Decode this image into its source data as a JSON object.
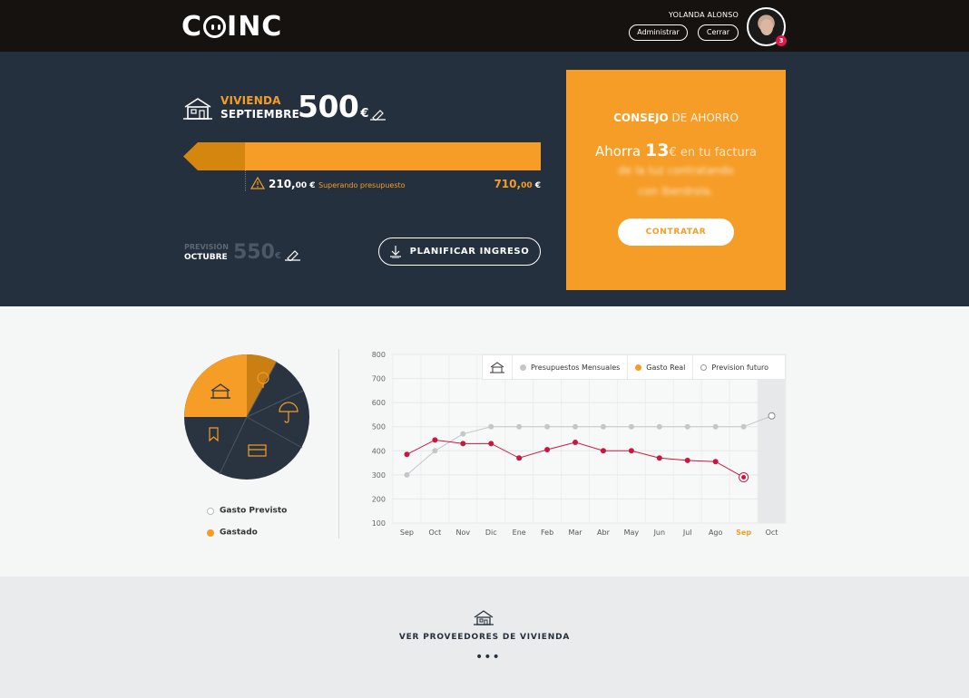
{
  "header": {
    "logo": "COINC",
    "user_name": "YOLANDA ALONSO",
    "admin_label": "Administrar",
    "logout_label": "Cerrar",
    "notifications": "3"
  },
  "budget": {
    "category": "VIVIENDA",
    "month": "SEPTIEMBRE",
    "amount": "500",
    "currency": "€",
    "progress_spent_fraction": 1.42,
    "over_amount_int": "210,",
    "over_amount_cents": "00",
    "over_currency": " €",
    "over_label": "Superando presupuesto",
    "spent_int": "710,",
    "spent_cents": "00",
    "spent_currency": " €"
  },
  "forecast": {
    "label": "PREVISIÓN",
    "month": "OCTUBRE",
    "amount": "550",
    "currency": "€",
    "plan_button": "PLANIFICAR INGRESO"
  },
  "tip": {
    "title_bold": "CONSEJO",
    "title_rest": " DE AHORRO",
    "lead": "Ahorra ",
    "amount": "13",
    "rest": "€ en tu factura",
    "line2": "de la luz contratando",
    "line3": "con Iberdrola.",
    "button": "CONTRATAR"
  },
  "pie_legend": {
    "planned": "Gasto Previsto",
    "spent": "Gastado"
  },
  "chart_legend": {
    "monthly": "Presupuestos Mensuales",
    "real": "Gasto Real",
    "future": "Prevision futuro"
  },
  "chart_data": {
    "type": "line",
    "categories": [
      "Sep",
      "Oct",
      "Nov",
      "Dic",
      "Ene",
      "Feb",
      "Mar",
      "Abr",
      "May",
      "Jun",
      "Jul",
      "Ago",
      "Sep",
      "Oct"
    ],
    "ylim": [
      100,
      800
    ],
    "yticks": [
      100,
      200,
      300,
      400,
      500,
      600,
      700,
      800
    ],
    "series": [
      {
        "name": "Presupuestos Mensuales",
        "values": [
          300,
          400,
          470,
          500,
          500,
          500,
          500,
          500,
          500,
          500,
          500,
          500,
          500,
          null
        ]
      },
      {
        "name": "Gasto Real",
        "values": [
          385,
          445,
          430,
          430,
          370,
          405,
          435,
          400,
          400,
          370,
          360,
          355,
          290,
          null
        ]
      },
      {
        "name": "Prevision futuro",
        "values": [
          null,
          null,
          null,
          null,
          null,
          null,
          null,
          null,
          null,
          null,
          null,
          null,
          500,
          545
        ]
      }
    ],
    "highlighted_category_index": 12,
    "colors": {
      "budget": "#c4c6c8",
      "real": "#c8173f",
      "future": "#ffffff",
      "highlight": "#f59d26"
    }
  },
  "footer": {
    "providers_label": "VER PROVEEDORES DE VIVIENDA",
    "more": "•••"
  },
  "colors": {
    "accent": "#f59d26",
    "dark": "#24303e",
    "topbar": "#161210",
    "alert": "#c8173f"
  }
}
